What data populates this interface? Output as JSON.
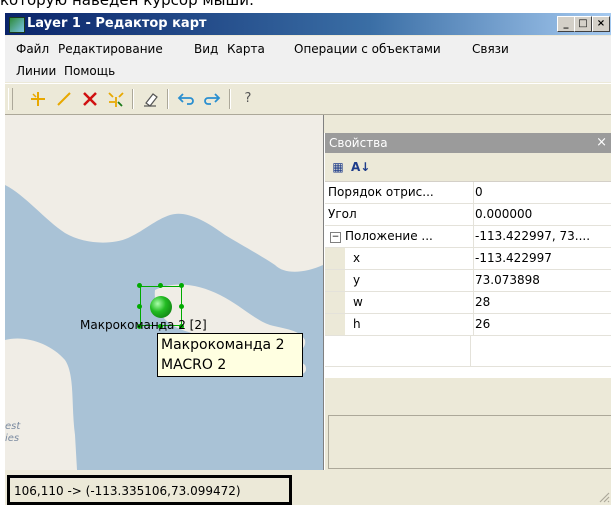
{
  "caption_fragment": "которую наведен курсор мыши:",
  "window": {
    "title": "Layer 1 - Редактор карт",
    "minimize_glyph": "_",
    "maximize_glyph": "□",
    "close_glyph": "×"
  },
  "menu": {
    "items": [
      "Файл",
      "Редактирование",
      "Вид",
      "Карта",
      "Операции с объектами",
      "Связи",
      "Линии",
      "Помощь"
    ]
  },
  "toolbar": {
    "icons": [
      "add-point-icon",
      "draw-line-icon",
      "delete-icon",
      "select-points-icon",
      "eraser-icon",
      "undo-icon",
      "redo-icon",
      "help-icon"
    ],
    "help_glyph": "?"
  },
  "map": {
    "object_label": "Макрокоманда 2 [2]",
    "tooltip_line1": "Макрокоманда 2",
    "tooltip_line2": "MACRO 2",
    "faint_line1": "est",
    "faint_line2": "ies"
  },
  "properties": {
    "title": "Свойства",
    "close_glyph": "×",
    "categorized_glyph": "▦",
    "sort_glyph": "A↓",
    "rows": [
      {
        "name": "Порядок отрис...",
        "value": "0"
      },
      {
        "name": "Угол",
        "value": "0.000000"
      },
      {
        "name": "Положение ...",
        "value": "-113.422997, 73....",
        "expander": "−"
      },
      {
        "name": "x",
        "value": "-113.422997"
      },
      {
        "name": "y",
        "value": "73.073898"
      },
      {
        "name": "w",
        "value": "28"
      },
      {
        "name": "h",
        "value": "26"
      }
    ]
  },
  "status": {
    "coordinates": "106,110 -> (-113.335106,73.099472)"
  },
  "colors": {
    "sea": "#a9c2d6",
    "land": "#f0ede6",
    "selection": "#00aa00",
    "marker": "#22bb22"
  }
}
